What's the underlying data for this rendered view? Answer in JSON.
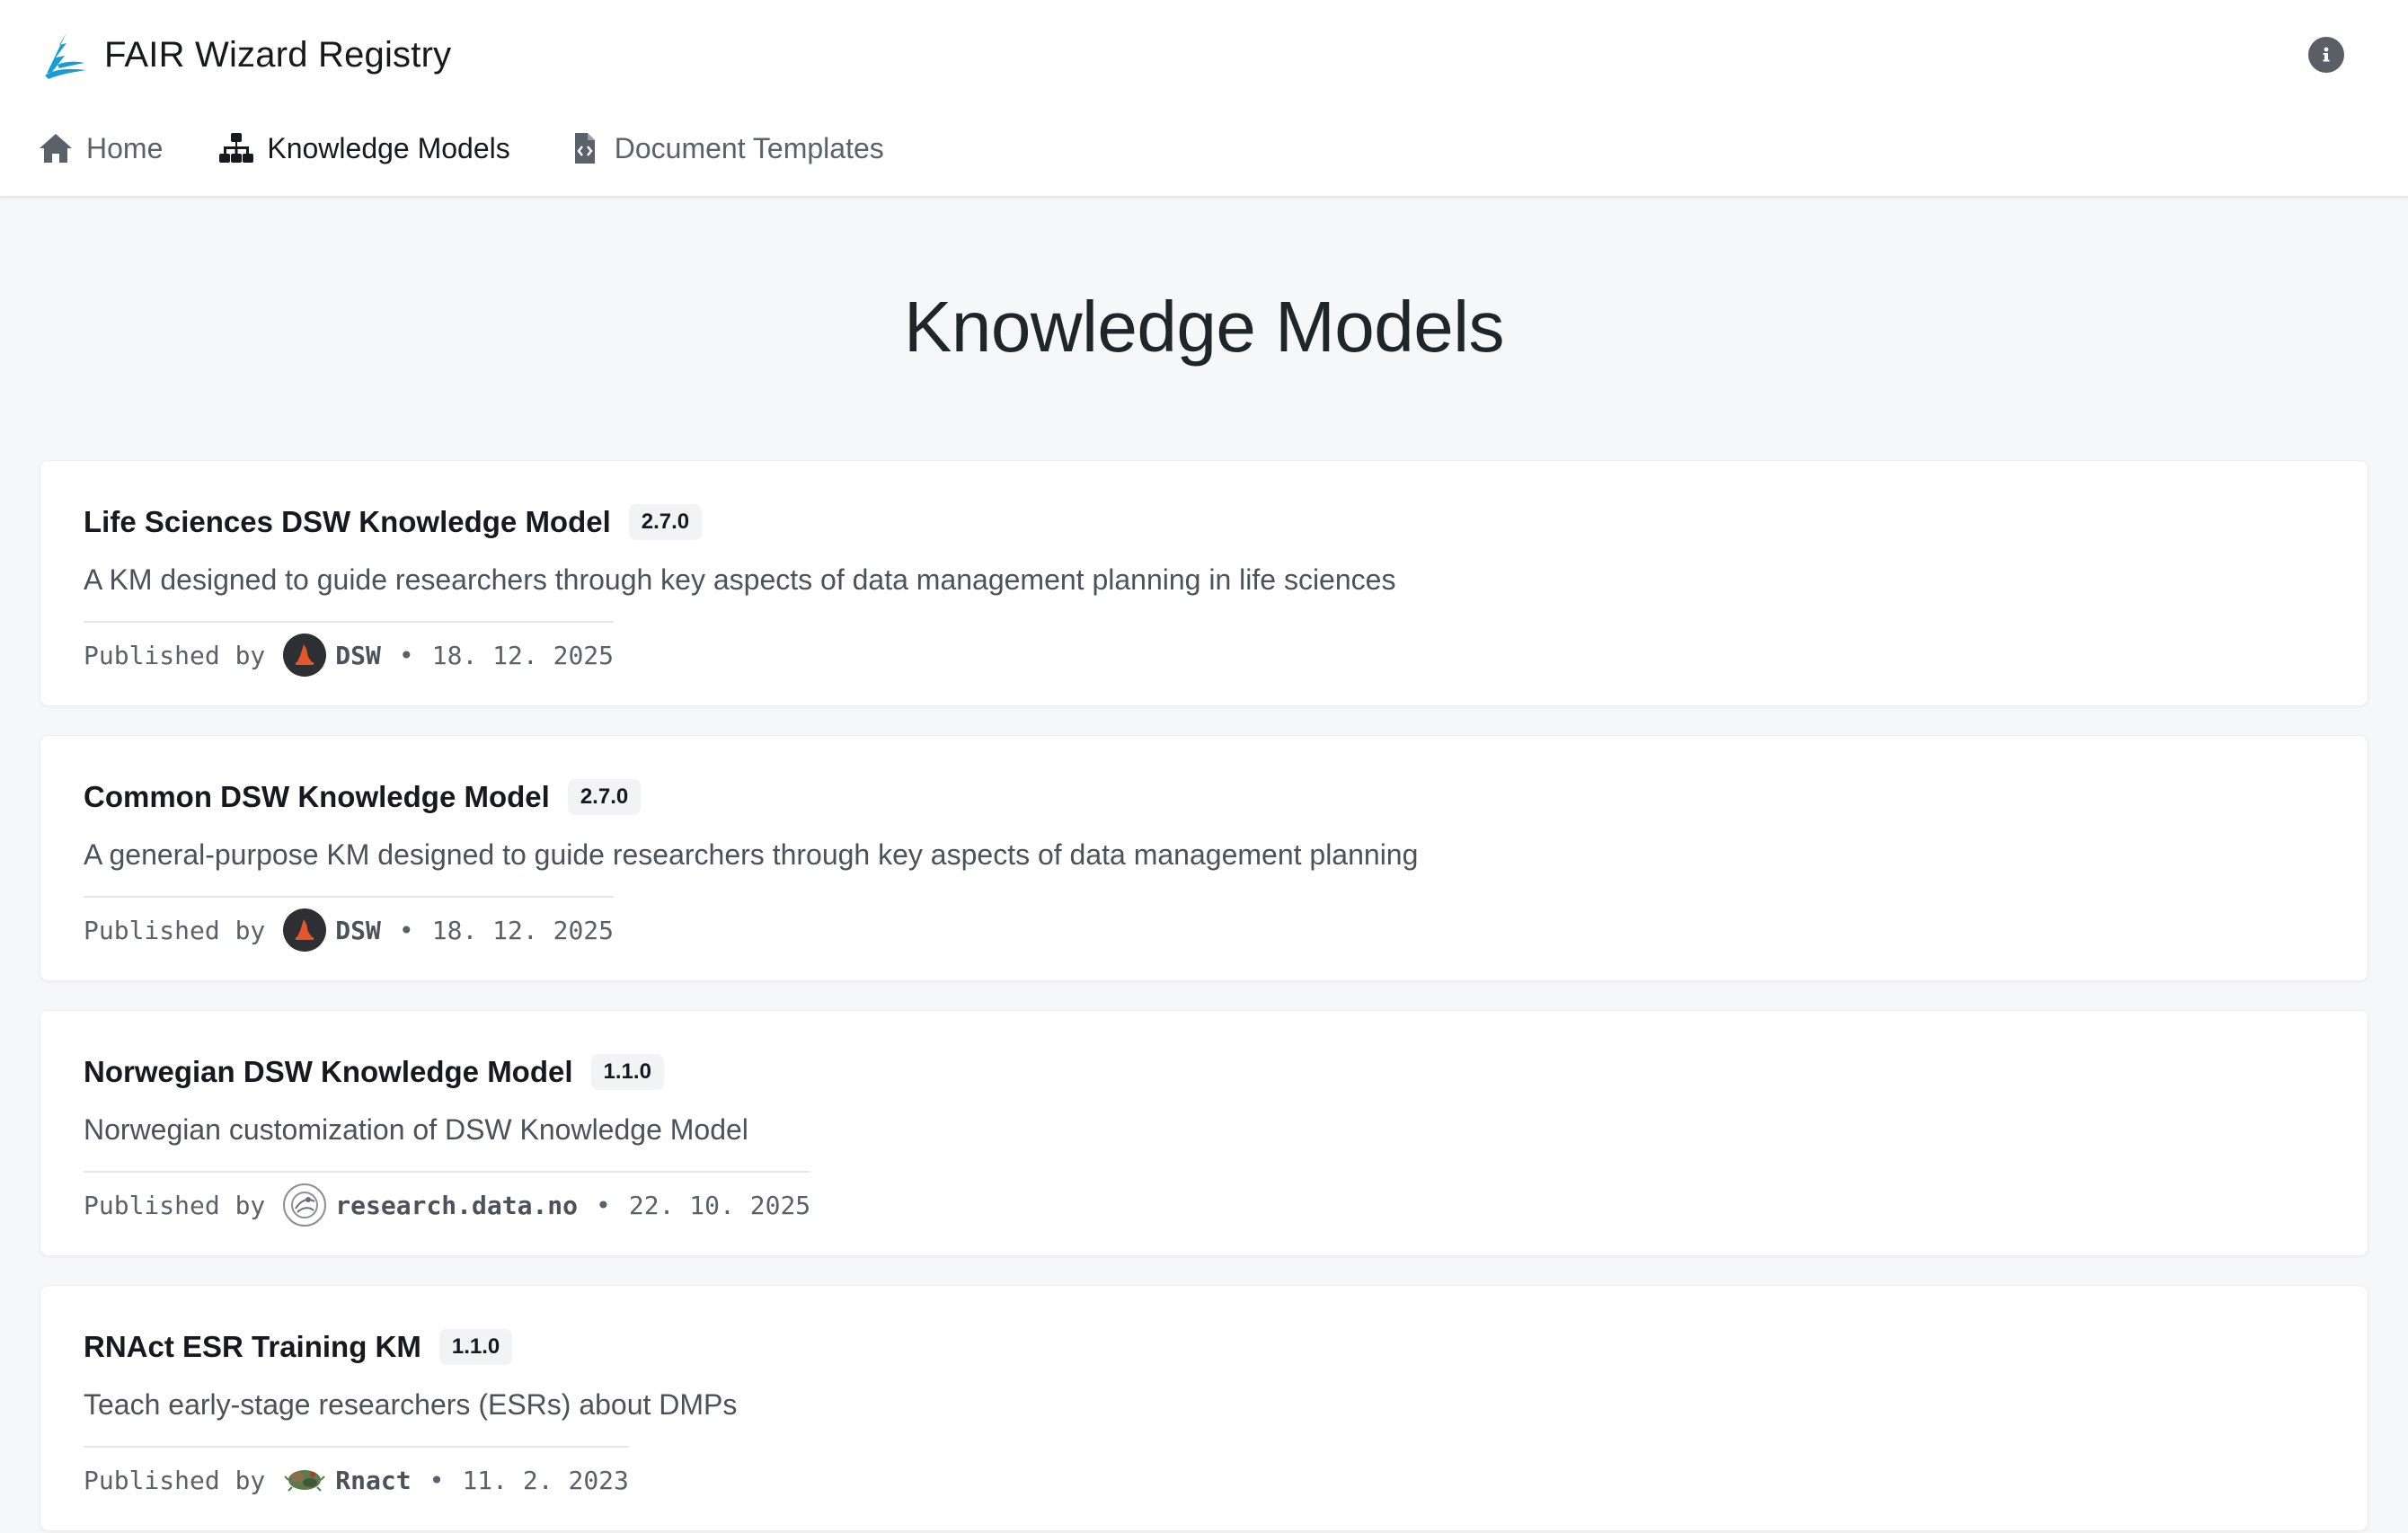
{
  "header": {
    "brand_name": "FAIR Wizard Registry",
    "brand_color": "#1a9bd6",
    "info_icon": "info-icon"
  },
  "nav": {
    "items": [
      {
        "label": "Home",
        "icon": "home-icon",
        "active": false
      },
      {
        "label": "Knowledge Models",
        "icon": "sitemap-icon",
        "active": true
      },
      {
        "label": "Document Templates",
        "icon": "file-code-icon",
        "active": false
      }
    ]
  },
  "main": {
    "title": "Knowledge Models",
    "published_by_label": "Published by",
    "separator": "•",
    "cards": [
      {
        "title": "Life Sciences DSW Knowledge Model",
        "version": "2.7.0",
        "description": "A KM designed to guide researchers through key aspects of data management planning in life sciences",
        "publisher": "DSW",
        "publisher_icon": "dsw-logo-icon",
        "date": "18. 12. 2025"
      },
      {
        "title": "Common DSW Knowledge Model",
        "version": "2.7.0",
        "description": "A general-purpose KM designed to guide researchers through key aspects of data management planning",
        "publisher": "DSW",
        "publisher_icon": "dsw-logo-icon",
        "date": "18. 12. 2025"
      },
      {
        "title": "Norwegian DSW Knowledge Model",
        "version": "1.1.0",
        "description": "Norwegian customization of DSW Knowledge Model",
        "publisher": "research.data.no",
        "publisher_icon": "research-data-no-logo-icon",
        "date": "22. 10. 2025"
      },
      {
        "title": "RNAct ESR Training KM",
        "version": "1.1.0",
        "description": "Teach early-stage researchers (ESRs) about DMPs",
        "publisher": "Rnact",
        "publisher_icon": "rnact-logo-icon",
        "date": "11. 2. 2023"
      }
    ]
  }
}
